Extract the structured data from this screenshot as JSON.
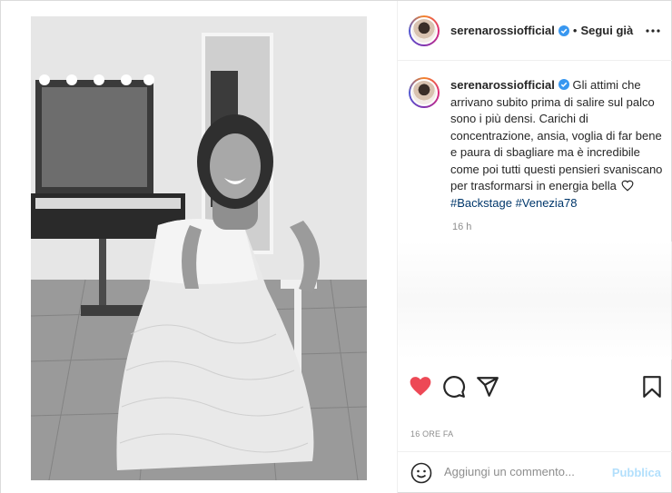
{
  "header": {
    "username": "serenarossiofficial",
    "separator": "•",
    "follow_label": "Segui già"
  },
  "caption": {
    "username": "serenarossiofficial",
    "text": "Gli attimi che arrivano subito prima di salire sul palco sono i più densi. Carichi di concentrazione, ansia, voglia di far bene e paura di sbagliare ma è incredibile come poi tutti questi pensieri svaniscano per trasformarsi in energia bella",
    "hashtags": [
      "#Backstage",
      "#Venezia78"
    ],
    "time": "16 h"
  },
  "actions": {
    "like_icon": "heart-filled-icon",
    "comment_icon": "comment-icon",
    "share_icon": "share-icon",
    "save_icon": "bookmark-icon",
    "like_color": "#ed4956"
  },
  "timestamp": "16 ORE FA",
  "comment": {
    "placeholder": "Aggiungi un commento...",
    "publish_label": "Pubblica",
    "publish_color": "#b2dffc"
  },
  "colors": {
    "verified": "#3897f0",
    "text": "#262626",
    "muted": "#8e8e8e",
    "hashtag": "#00376b"
  }
}
